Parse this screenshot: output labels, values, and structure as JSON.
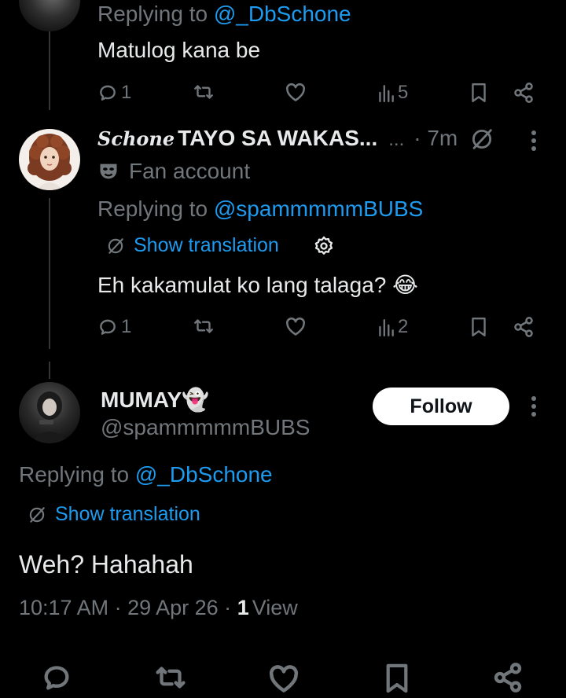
{
  "tweet1": {
    "replying_prefix": "Replying to",
    "replying_handle": "@_DbSchone",
    "text": "Matulog kana be",
    "replies": "1",
    "views": "5"
  },
  "tweet2": {
    "name_script": "Schone",
    "name_bold": "TAYO SA WAKAS...",
    "name_dots": "...",
    "time": "· 7m",
    "badge_label": "Fan account",
    "replying_prefix": "Replying to",
    "replying_handle": "@spammmmmBUBS",
    "translate_label": "Show translation",
    "text": "Eh kakamulat ko lang talaga?",
    "emoji": "😂",
    "replies": "1",
    "views": "2"
  },
  "main": {
    "name": "MUMAY",
    "name_emoji": "👻",
    "handle": "@spammmmmBUBS",
    "follow_label": "Follow",
    "replying_prefix": "Replying to",
    "replying_handle": "@_DbSchone",
    "translate_label": "Show translation",
    "text": "Weh? Hahahah",
    "timestamp": "10:17 AM · 29 Apr 26 ·",
    "view_count": "1",
    "view_label": "View"
  },
  "colors": {
    "background": "#000000",
    "text": "#e7e9ea",
    "secondary": "#71767b",
    "link": "#1d9bf0",
    "follow_bg": "#ffffff"
  },
  "icons": [
    "reply-icon",
    "retweet-icon",
    "like-icon",
    "views-icon",
    "bookmark-icon",
    "share-icon",
    "more-icon",
    "translate-icon",
    "settings-icon",
    "mask-icon"
  ]
}
